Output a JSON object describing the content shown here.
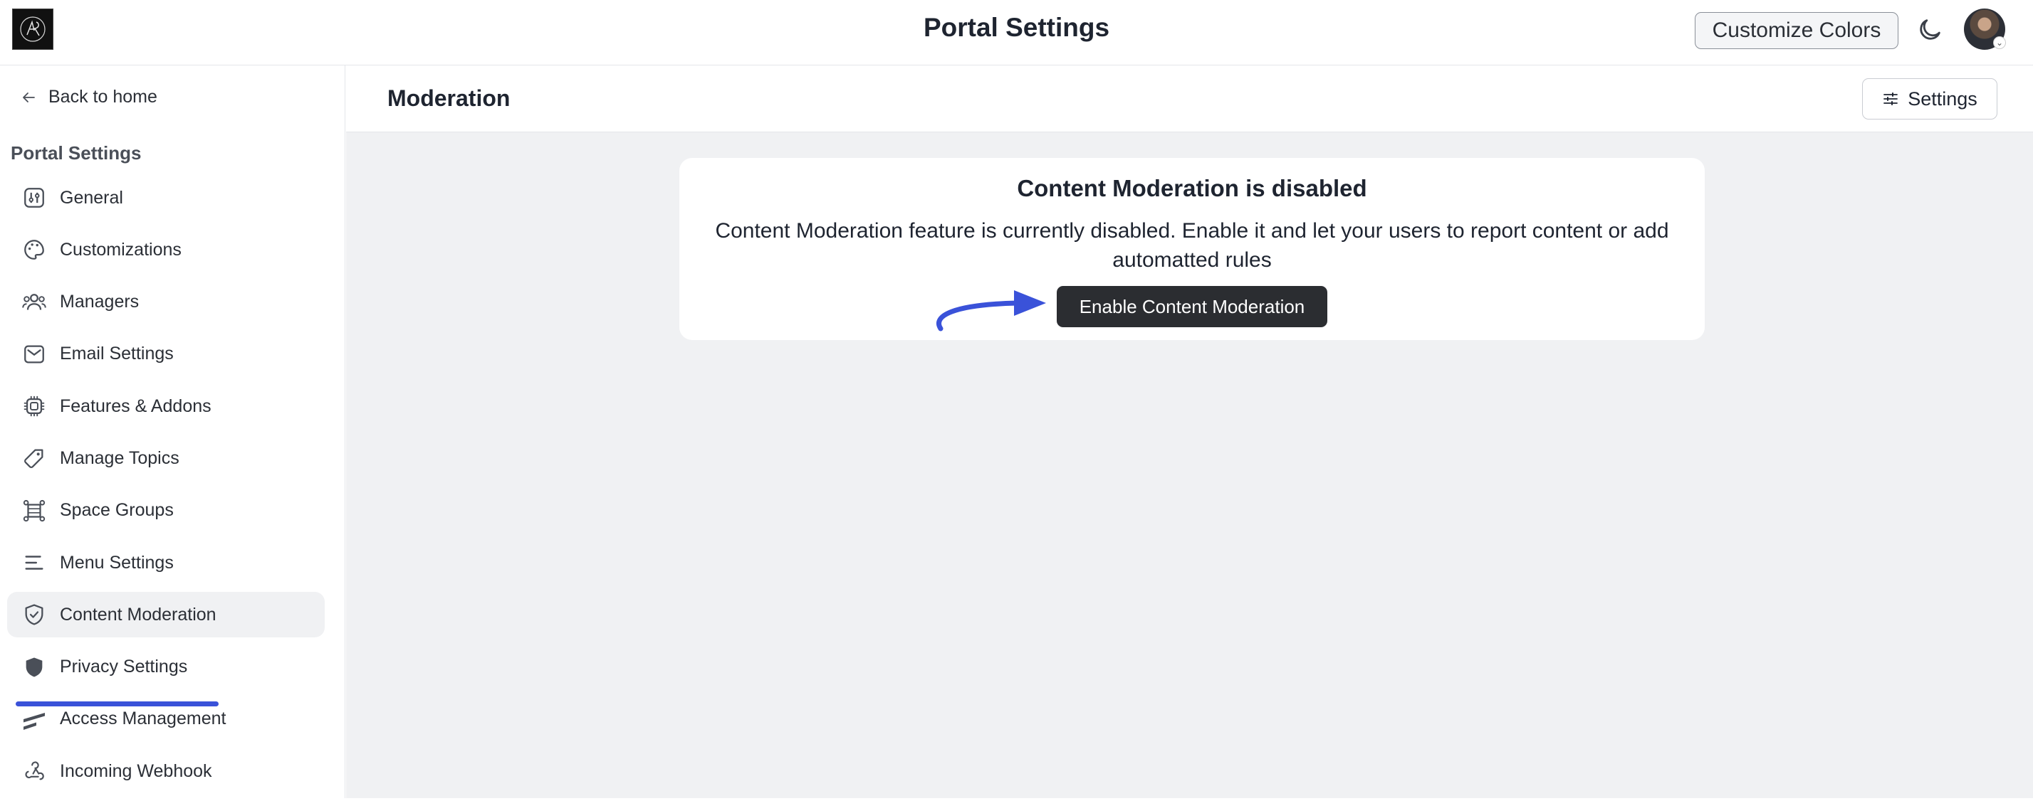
{
  "app": {
    "title": "Portal Settings",
    "customize_label": "Customize Colors"
  },
  "sidebar": {
    "back_label": "Back to home",
    "section_title": "Portal Settings",
    "items": [
      {
        "label": "General",
        "icon": "sliders-square-icon",
        "active": false
      },
      {
        "label": "Customizations",
        "icon": "palette-icon",
        "active": false
      },
      {
        "label": "Managers",
        "icon": "users-icon",
        "active": false
      },
      {
        "label": "Email Settings",
        "icon": "mail-icon",
        "active": false
      },
      {
        "label": "Features & Addons",
        "icon": "chip-icon",
        "active": false
      },
      {
        "label": "Manage Topics",
        "icon": "tag-icon",
        "active": false
      },
      {
        "label": "Space Groups",
        "icon": "frame-icon",
        "active": false
      },
      {
        "label": "Menu Settings",
        "icon": "menu-lines-icon",
        "active": false
      },
      {
        "label": "Content Moderation",
        "icon": "shield-check-icon",
        "active": true
      },
      {
        "label": "Privacy Settings",
        "icon": "shield-icon",
        "active": false
      },
      {
        "label": "Access Management",
        "icon": "stripes-icon",
        "active": false
      },
      {
        "label": "Incoming Webhook",
        "icon": "webhook-icon",
        "active": false
      }
    ]
  },
  "header": {
    "title": "Moderation",
    "settings_label": "Settings"
  },
  "card": {
    "title": "Content Moderation is disabled",
    "text": "Content Moderation feature is currently disabled. Enable it and let your users to report content or add automatted rules",
    "button_label": "Enable Content Moderation"
  },
  "colors": {
    "accent_annotation": "#3a52d9",
    "button_dark": "#2b2d31",
    "main_bg": "#f0f1f3"
  }
}
